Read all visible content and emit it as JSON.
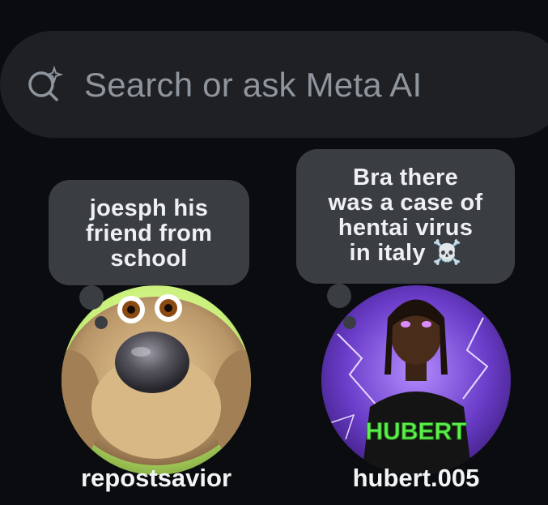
{
  "search": {
    "placeholder": "Search or ask Meta AI",
    "icon": "meta-ai-search-icon"
  },
  "notes": [
    {
      "username": "repostsavior",
      "note": "joesph his\nfriend from\nschool",
      "avatar_icon": "talking-dog-avatar"
    },
    {
      "username": "hubert.005",
      "note": "Bra there\nwas a case of\nhentai virus\nin italy ☠️",
      "avatar_icon": "hubert-avatar",
      "avatar_shirt_text": "HUBERT"
    }
  ],
  "colors": {
    "background": "#0b0c10",
    "search_bar": "#1e2024",
    "note_bubble": "#3a3d42",
    "placeholder_text": "#8f959c"
  }
}
